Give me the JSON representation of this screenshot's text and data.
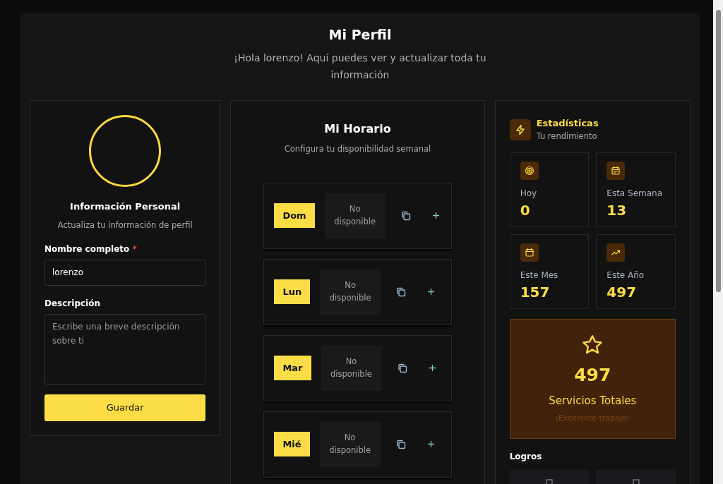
{
  "header": {
    "title": "Mi Perfil",
    "subtitle": "¡Hola lorenzo! Aquí puedes ver y actualizar toda tu información"
  },
  "profile": {
    "title": "Información Personal",
    "subtitle": "Actualiza tu información de perfil",
    "name_field": {
      "label": "Nombre completo",
      "required_mark": "*",
      "value": "lorenzo"
    },
    "description_field": {
      "label": "Descripción",
      "placeholder": "Escribe una breve descripción sobre ti"
    },
    "save_button": "Guardar"
  },
  "schedule": {
    "title": "Mi Horario",
    "subtitle": "Configura tu disponibilidad semanal",
    "days": [
      {
        "day": "Dom",
        "status": "No disponible"
      },
      {
        "day": "Lun",
        "status": "No disponible"
      },
      {
        "day": "Mar",
        "status": "No disponible"
      },
      {
        "day": "Mié",
        "status": "No disponible"
      }
    ]
  },
  "stats": {
    "title": "Estadísticas",
    "subtitle": "Tu rendimiento",
    "items": [
      {
        "kind": "target",
        "label": "Hoy",
        "value": "0"
      },
      {
        "kind": "week",
        "label": "Esta Semana",
        "value": "13"
      },
      {
        "kind": "month",
        "label": "Este Mes",
        "value": "157"
      },
      {
        "kind": "trend",
        "label": "Este Año",
        "value": "497"
      }
    ],
    "total": {
      "value": "497",
      "label": "Servicios Totales",
      "note": "¡Excelente trabajo!"
    },
    "achievements_title": "Logros"
  }
}
